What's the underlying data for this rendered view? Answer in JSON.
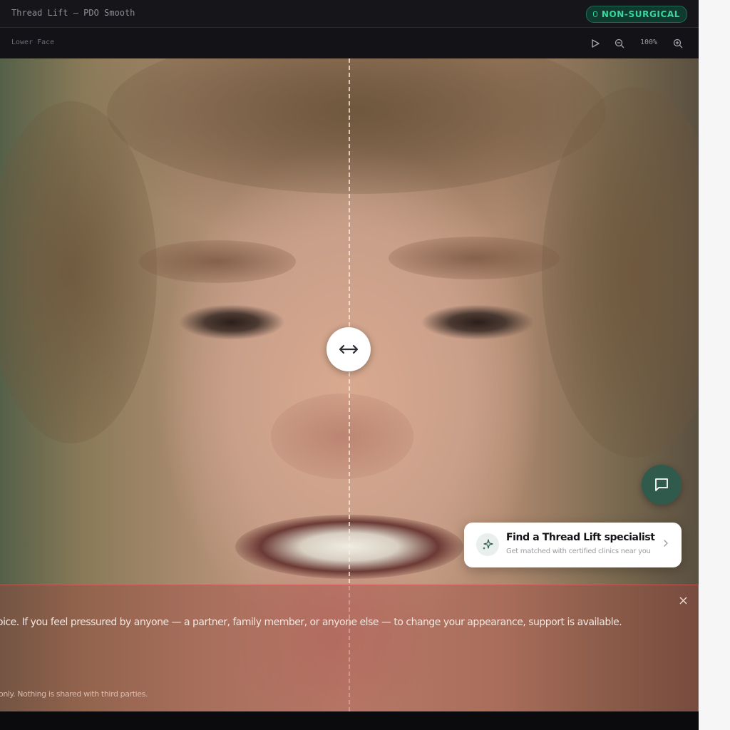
{
  "app": {
    "title": "Thread Lift — PDO Smooth",
    "badge": {
      "label": "NON-SURGICAL",
      "icon": "shield-icon",
      "color": "#3ad69f"
    }
  },
  "toolbar": {
    "area_label": "Lower Face",
    "play_icon": "play-icon",
    "zoom_out_icon": "zoom-out-icon",
    "zoom_level": "100%",
    "zoom_in_icon": "zoom-in-icon"
  },
  "viewer": {
    "image_description": "photo-of-smiling-person",
    "split_handle_icon": "left-right-arrow-icon"
  },
  "chat": {
    "icon": "chat-bubble-icon",
    "color": "#2f5a4c"
  },
  "specialist_card": {
    "icon": "sparkle-icon",
    "title": "Find a Thread Lift specialist",
    "subtitle": "Get matched with certified clinics near you",
    "chevron_icon": "chevron-right-icon"
  },
  "notice": {
    "message": "oice. If you feel pressured by anyone — a partner, family member, or anyone else — to change your appearance, support is available.",
    "footnote": "only. Nothing is shared with third parties.",
    "close_icon": "close-icon"
  }
}
